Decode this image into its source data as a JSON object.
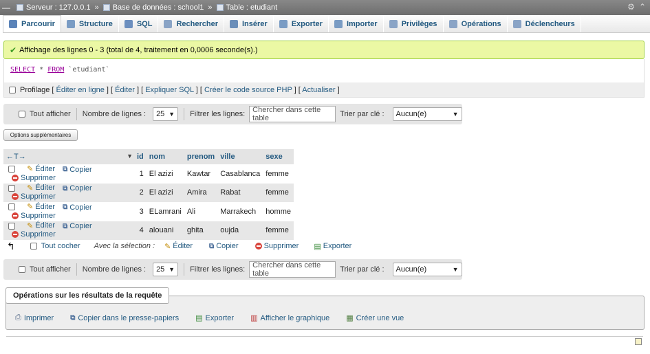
{
  "breadcrumb": {
    "server": "Serveur : 127.0.0.1",
    "database": "Base de données : school1",
    "table": "Table : etudiant"
  },
  "tabs": [
    {
      "label": "Parcourir",
      "icon": "browse-icon",
      "color": "#5b83b8"
    },
    {
      "label": "Structure",
      "icon": "structure-icon",
      "color": "#7a9cc4"
    },
    {
      "label": "SQL",
      "icon": "sql-icon",
      "color": "#6c8fbf"
    },
    {
      "label": "Rechercher",
      "icon": "search-icon",
      "color": "#8aa4c6"
    },
    {
      "label": "Insérer",
      "icon": "insert-icon",
      "color": "#6b8eb9"
    },
    {
      "label": "Exporter",
      "icon": "export-icon",
      "color": "#7a9cc4"
    },
    {
      "label": "Importer",
      "icon": "import-icon",
      "color": "#7a9cc4"
    },
    {
      "label": "Privilèges",
      "icon": "privileges-icon",
      "color": "#8aa4c6"
    },
    {
      "label": "Opérations",
      "icon": "wrench-icon",
      "color": "#8aa4c6"
    },
    {
      "label": "Déclencheurs",
      "icon": "triggers-icon",
      "color": "#8aa4c6"
    }
  ],
  "success_message": "Affichage des lignes 0 - 3 (total de 4, traitement en 0,0006 seconde(s).)",
  "sql": {
    "select": "SELECT",
    "star": " * ",
    "from": "FROM",
    "table": " `etudiant`"
  },
  "profiling": {
    "label": "Profilage",
    "links": [
      "Éditer en ligne",
      "Éditer",
      "Expliquer SQL",
      "Créer le code source PHP",
      "Actualiser"
    ]
  },
  "navbar": {
    "show_all": "Tout afficher",
    "rows_label": "Nombre de lignes :",
    "rows_value": "25",
    "filter_label": "Filtrer les lignes:",
    "filter_placeholder": "Chercher dans cette table",
    "sort_label": "Trier par clé :",
    "sort_value": "Aucun(e)"
  },
  "extra_options": "Options supplémentaires",
  "table": {
    "arrows": "←T→",
    "columns": [
      "id",
      "nom",
      "prenom",
      "ville",
      "sexe"
    ],
    "actions": {
      "edit": "Éditer",
      "copy": "Copier",
      "delete": "Supprimer"
    },
    "rows": [
      {
        "id": "1",
        "nom": "El azizi",
        "prenom": "Kawtar",
        "ville": "Casablanca",
        "sexe": "femme"
      },
      {
        "id": "2",
        "nom": "El azizi",
        "prenom": "Amira",
        "ville": "Rabat",
        "sexe": "femme"
      },
      {
        "id": "3",
        "nom": "ELamrani",
        "prenom": "Ali",
        "ville": "Marrakech",
        "sexe": "homme"
      },
      {
        "id": "4",
        "nom": "alouani",
        "prenom": "ghita",
        "ville": "oujda",
        "sexe": "femme"
      }
    ]
  },
  "bulk": {
    "check_all": "Tout cocher",
    "with_selection": "Avec la sélection :",
    "edit": "Éditer",
    "copy": "Copier",
    "delete": "Supprimer",
    "export": "Exporter"
  },
  "query_ops": {
    "title": "Opérations sur les résultats de la requête",
    "print": "Imprimer",
    "copy_clipboard": "Copier dans le presse-papiers",
    "export": "Exporter",
    "chart": "Afficher le graphique",
    "create_view": "Créer une vue"
  }
}
